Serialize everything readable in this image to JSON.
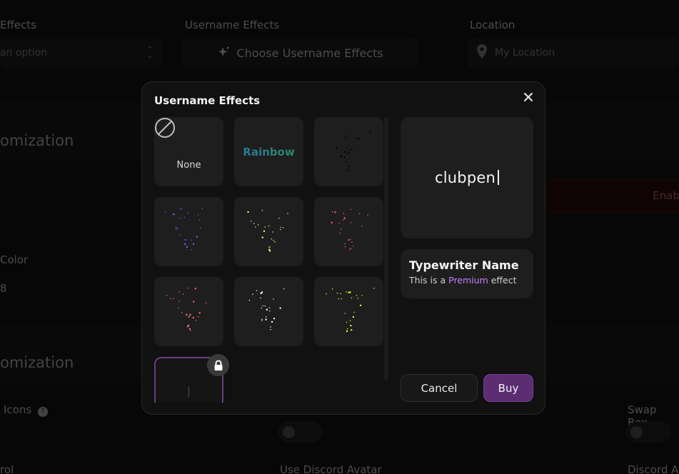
{
  "background": {
    "col1_label": "Effects",
    "col1_placeholder": "an option",
    "col2_label": "Username Effects",
    "col2_button": "Choose Username Effects",
    "col3_label": "Location",
    "col3_placeholder": "My Location",
    "section1_heading": "omization",
    "enable_label": "Enab",
    "color_label": "Color",
    "color_value": "8",
    "section2_heading": "omization",
    "icons_label": "Icons",
    "swap_label": "Swap Box",
    "bottom1_label": "rol",
    "bottom2_label": "Use Discord Avatar",
    "bottom3_label": "Discord A"
  },
  "modal": {
    "title": "Username Effects",
    "tiles": {
      "none_label": "None",
      "rainbow_label": "Rainbow"
    },
    "preview": {
      "text": "clubpen"
    },
    "effect": {
      "name": "Typewriter Name",
      "desc_prefix": "This is a",
      "desc_tier": "Premium",
      "desc_suffix": "effect"
    },
    "cancel_label": "Cancel",
    "buy_label": "Buy"
  },
  "colors": {
    "accent": "#5c2d72",
    "premium": "#c084fc",
    "sparkle_white": "#ffffff",
    "sparkle_blue": "#6b6bff",
    "sparkle_yellowgreen": "#e8ff7a",
    "sparkle_pink": "#ff5d8f",
    "sparkle_red": "#ff6b6b",
    "sparkle_yellow": "#f5f53a"
  }
}
